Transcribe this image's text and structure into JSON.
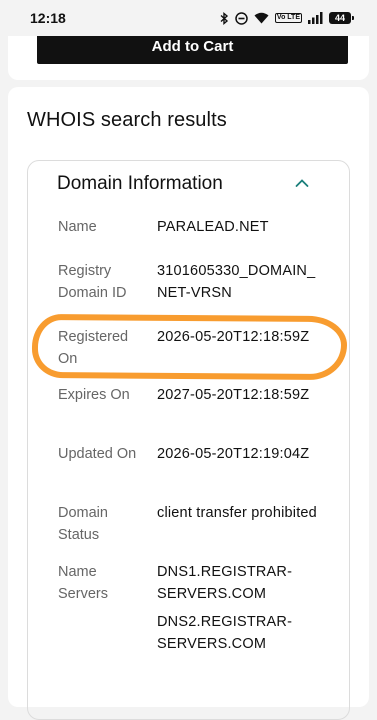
{
  "status_bar": {
    "time": "12:18",
    "network_badge": "Vo LTE",
    "battery": "44"
  },
  "cart": {
    "button_label": "Add to Cart"
  },
  "whois": {
    "title": "WHOIS search results",
    "section_title": "Domain Information",
    "rows": [
      {
        "label": "Name",
        "value": "PARALEAD.NET"
      },
      {
        "label": "Registry Domain ID",
        "value": "3101605330_DOMAIN_NET-VRSN"
      },
      {
        "label": "Registered On",
        "value": "2026-05-20T12:18:59Z"
      },
      {
        "label": "Expires On",
        "value": "2027-05-20T12:18:59Z"
      },
      {
        "label": "Updated On",
        "value": "2026-05-20T12:19:04Z"
      },
      {
        "label": "Domain Status",
        "value": "client transfer prohibited"
      },
      {
        "label": "Name Servers",
        "values": [
          "DNS1.REGISTRAR-SERVERS.COM",
          "DNS2.REGISTRAR-SERVERS.COM"
        ]
      }
    ]
  },
  "colors": {
    "highlight": "#f7941d",
    "button_bg": "#111111",
    "accent_teal": "#1a7f7a"
  },
  "icons": [
    "bluetooth-icon",
    "do-not-disturb-icon",
    "wifi-icon",
    "signal-icon",
    "battery-icon",
    "chevron-up-icon"
  ]
}
